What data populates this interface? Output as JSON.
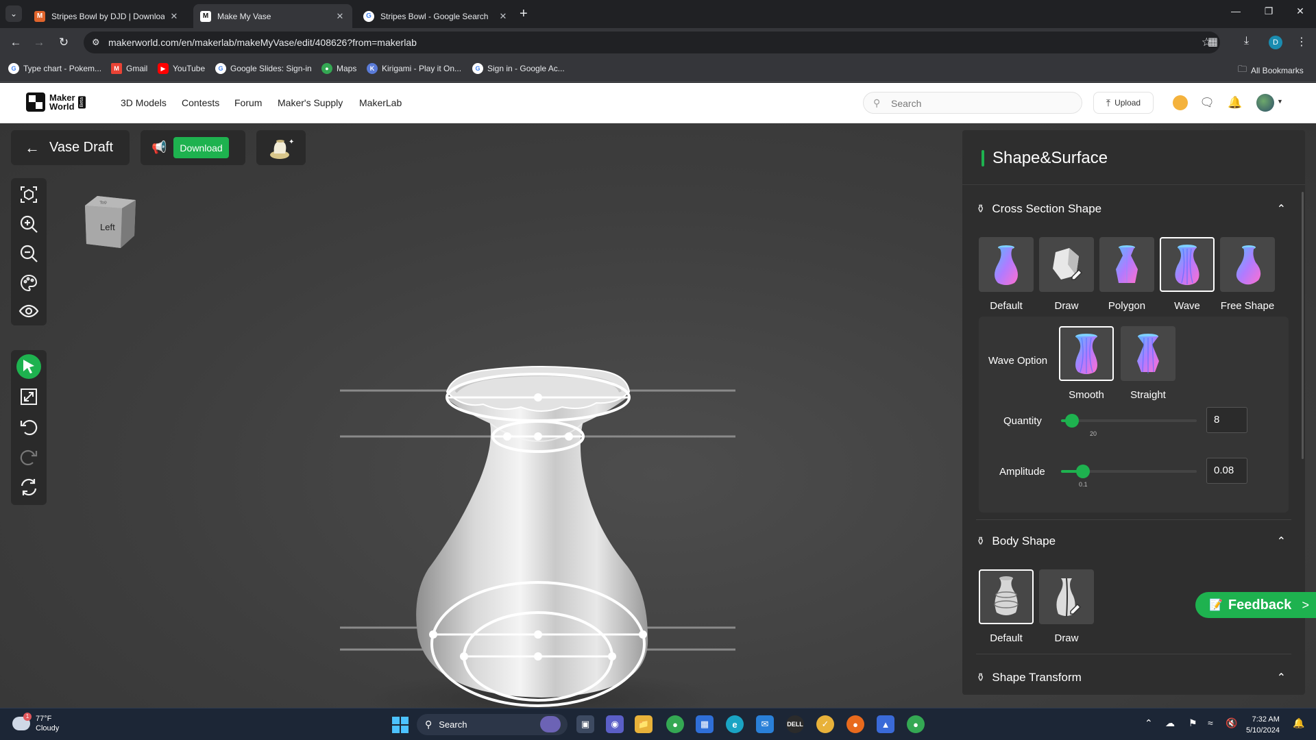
{
  "browser": {
    "tabs": [
      {
        "title": "Stripes Bowl by DJD | Download",
        "favicon": "makerworld-icon",
        "active": false
      },
      {
        "title": "Make My Vase",
        "favicon": "makerworld-icon",
        "active": true
      },
      {
        "title": "Stripes Bowl - Google Search",
        "favicon": "google-icon",
        "active": false
      }
    ],
    "url": "makerworld.com/en/makerlab/makeMyVase/edit/408626?from=makerlab",
    "profile_initial": "D",
    "bookmarks": [
      {
        "label": "Type chart - Pokem...",
        "icon": "google-icon"
      },
      {
        "label": "Gmail",
        "icon": "gmail-icon"
      },
      {
        "label": "YouTube",
        "icon": "youtube-icon"
      },
      {
        "label": "Google Slides: Sign-in",
        "icon": "google-icon"
      },
      {
        "label": "Maps",
        "icon": "maps-icon"
      },
      {
        "label": "Kirigami - Play it On...",
        "icon": "kirigami-icon"
      },
      {
        "label": "Sign in - Google Ac...",
        "icon": "google-icon"
      }
    ],
    "all_bookmarks": "All Bookmarks"
  },
  "site": {
    "logo_line1": "Maker",
    "logo_line2": "World",
    "logo_badge": "Beta",
    "nav": [
      "3D Models",
      "Contests",
      "Forum",
      "Maker's Supply",
      "MakerLab"
    ],
    "search_placeholder": "Search",
    "upload_label": "Upload"
  },
  "editor": {
    "back_label": "Vase Draft",
    "download_label": "Download",
    "viewcube_label": "Left",
    "viewcube_top": "Top",
    "tools": [
      "fit-view-icon",
      "zoom-in-icon",
      "zoom-out-icon",
      "palette-icon",
      "eye-icon"
    ],
    "tools2": [
      "select-icon",
      "resize-icon",
      "undo-icon",
      "redo-icon",
      "reset-icon"
    ]
  },
  "panel": {
    "title": "Shape&Surface",
    "cross_section": {
      "title": "Cross Section Shape",
      "options": [
        "Default",
        "Draw",
        "Polygon",
        "Wave",
        "Free Shape"
      ],
      "selected": "Wave",
      "wave_option_label": "Wave Option",
      "wave_options": [
        "Smooth",
        "Straight"
      ],
      "wave_selected": "Smooth",
      "quantity_label": "Quantity",
      "quantity_value": "8",
      "quantity_tick": "20",
      "quantity_fraction": 0.08,
      "amplitude_label": "Amplitude",
      "amplitude_value": "0.08",
      "amplitude_tick": "0.1",
      "amplitude_fraction": 0.16
    },
    "body_shape": {
      "title": "Body Shape",
      "options": [
        "Default",
        "Draw"
      ],
      "selected": "Default"
    },
    "shape_transform": {
      "title": "Shape Transform"
    }
  },
  "feedback_label": "Feedback",
  "taskbar": {
    "weather_temp": "77°F",
    "weather_desc": "Cloudy",
    "weather_badge": "1",
    "search_label": "Search",
    "time": "7:32 AM",
    "date": "5/10/2024"
  },
  "colors": {
    "accent": "#1eb24f",
    "panel_bg": "#2e2e2e",
    "viewport_bg": "#3e3e3e"
  }
}
